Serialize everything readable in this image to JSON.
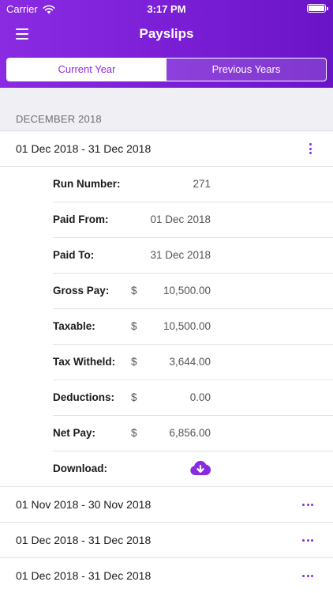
{
  "status": {
    "carrier": "Carrier",
    "time": "3:17 PM"
  },
  "nav": {
    "title": "Payslips"
  },
  "tabs": {
    "current": "Current Year",
    "previous": "Previous Years"
  },
  "section": {
    "header": "DECEMBER 2018"
  },
  "expanded_payslip": {
    "period": "01 Dec 2018 - 31 Dec 2018",
    "details": [
      {
        "label": "Run Number:",
        "currency": "",
        "value": "271"
      },
      {
        "label": "Paid From:",
        "currency": "",
        "value": "01 Dec 2018"
      },
      {
        "label": "Paid To:",
        "currency": "",
        "value": "31 Dec 2018"
      },
      {
        "label": "Gross Pay:",
        "currency": "$",
        "value": "10,500.00"
      },
      {
        "label": "Taxable:",
        "currency": "$",
        "value": "10,500.00"
      },
      {
        "label": "Tax Witheld:",
        "currency": "$",
        "value": "3,644.00"
      },
      {
        "label": "Deductions:",
        "currency": "$",
        "value": "0.00"
      },
      {
        "label": "Net Pay:",
        "currency": "$",
        "value": "6,856.00"
      }
    ],
    "download_label": "Download:"
  },
  "other_payslips": [
    {
      "period": "01 Nov 2018 - 30 Nov 2018"
    },
    {
      "period": "01 Dec 2018 - 31 Dec 2018"
    },
    {
      "period": "01 Dec 2018 - 31 Dec 2018"
    }
  ],
  "icons": {
    "menu": "hamburger-menu-icon",
    "expanded_more": "vertical-ellipsis-icon",
    "collapsed_more": "horizontal-ellipsis-icon",
    "download": "cloud-download-icon"
  },
  "colors": {
    "accent": "#8a2be2",
    "header_bg": "#efeff4"
  }
}
